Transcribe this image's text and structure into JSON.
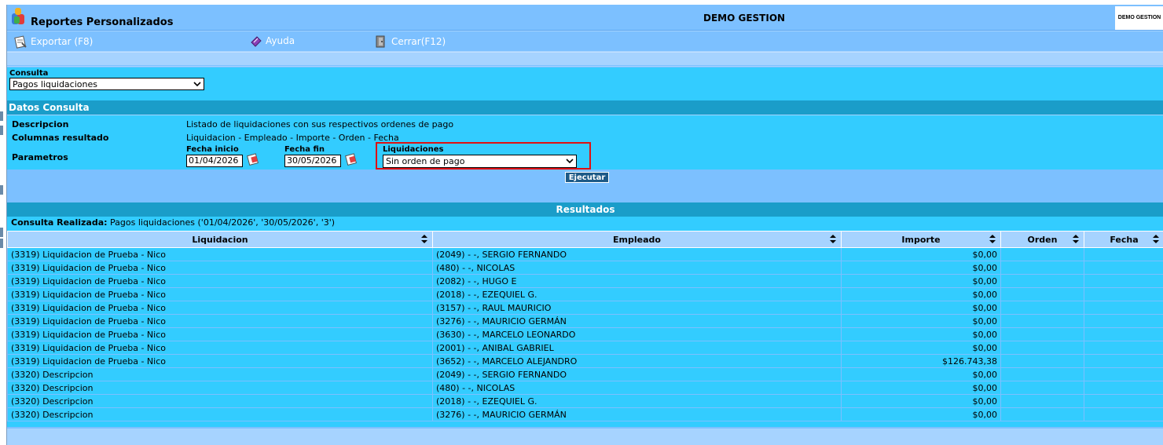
{
  "app": {
    "title": "Reportes Personalizados",
    "company": "DEMO GESTION",
    "company_logo_text": "DEMO GESTION"
  },
  "toolbar": {
    "export_label": "Exportar (F8)",
    "help_label": "Ayuda",
    "close_label": "Cerrar(F12)"
  },
  "consulta": {
    "label": "Consulta",
    "selected": "Pagos liquidaciones"
  },
  "datos": {
    "header": "Datos Consulta",
    "descripcion_label": "Descripcion",
    "descripcion_value": "Listado de liquidaciones con sus respectivos ordenes de pago",
    "columnas_label": "Columnas resultado",
    "columnas_value": "Liquidacion - Empleado - Importe - Orden - Fecha",
    "parametros_label": "Parametros",
    "fecha_inicio_label": "Fecha inicio",
    "fecha_inicio_value": "01/04/2026",
    "fecha_fin_label": "Fecha fin",
    "fecha_fin_value": "30/05/2026",
    "liquidaciones_label": "Liquidaciones",
    "liquidaciones_selected": "Sin orden de pago",
    "ejecutar_label": "Ejecutar"
  },
  "results": {
    "header": "Resultados",
    "consulta_realizada_label": "Consulta Realizada:",
    "consulta_realizada_value": "Pagos liquidaciones ('01/04/2026', '30/05/2026', '3')",
    "columns": [
      "Liquidacion",
      "Empleado",
      "Importe",
      "Orden",
      "Fecha"
    ],
    "rows": [
      [
        "(3319) Liquidacion de Prueba - Nico",
        "(2049) - -, SERGIO FERNANDO",
        "$0,00",
        "",
        ""
      ],
      [
        "(3319) Liquidacion de Prueba - Nico",
        "(480) - -, NICOLAS",
        "$0,00",
        "",
        ""
      ],
      [
        "(3319) Liquidacion de Prueba - Nico",
        "(2082) - -, HUGO E",
        "$0,00",
        "",
        ""
      ],
      [
        "(3319) Liquidacion de Prueba - Nico",
        "(2018) - -, EZEQUIEL G.",
        "$0,00",
        "",
        ""
      ],
      [
        "(3319) Liquidacion de Prueba - Nico",
        "(3157) - -, RAUL MAURICIO",
        "$0,00",
        "",
        ""
      ],
      [
        "(3319) Liquidacion de Prueba - Nico",
        "(3276) - -, MAURICIO GERMÁN",
        "$0,00",
        "",
        ""
      ],
      [
        "(3319) Liquidacion de Prueba - Nico",
        "(3630) - -, MARCELO LEONARDO",
        "$0,00",
        "",
        ""
      ],
      [
        "(3319) Liquidacion de Prueba - Nico",
        "(2001) - -, ANIBAL GABRIEL",
        "$0,00",
        "",
        ""
      ],
      [
        "(3319) Liquidacion de Prueba - Nico",
        "(3652) - -, MARCELO ALEJANDRO",
        "$126.743,38",
        "",
        ""
      ],
      [
        "(3320) Descripcion",
        "(2049) - -, SERGIO FERNANDO",
        "$0,00",
        "",
        ""
      ],
      [
        "(3320) Descripcion",
        "(480) - -, NICOLAS",
        "$0,00",
        "",
        ""
      ],
      [
        "(3320) Descripcion",
        "(2018) - -, EZEQUIEL G.",
        "$0,00",
        "",
        ""
      ],
      [
        "(3320) Descripcion",
        "(3276) - -, MAURICIO GERMÁN",
        "$0,00",
        "",
        ""
      ]
    ]
  },
  "icons": {
    "logo": "app-logo-icon",
    "export": "export-icon",
    "help": "help-icon",
    "close": "close-door-icon",
    "calendar": "calendar-icon",
    "sort": "sort-icon",
    "dropdown": "chevron-down-icon"
  },
  "colors": {
    "titlebar": "#7cc0ff",
    "panel": "#33ccff",
    "section_header": "#1a9dc9",
    "background": "#a6d3ff",
    "highlight": "#e01010",
    "button": "#1d5a87"
  }
}
